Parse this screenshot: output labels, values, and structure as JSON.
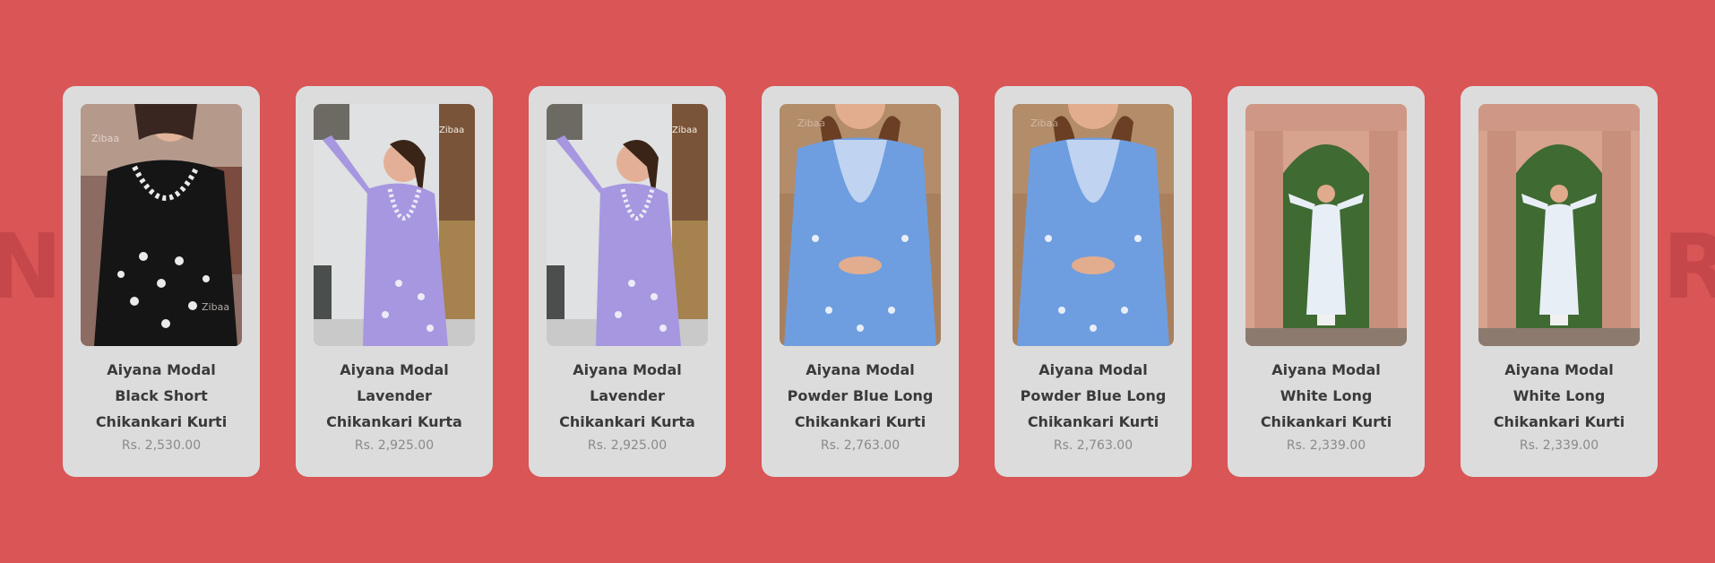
{
  "background": {
    "left_text": "N",
    "right_text": "R",
    "color": "#d95556"
  },
  "products": [
    {
      "title": "Aiyana Modal Black Short Chikankari Kurti",
      "price": "Rs. 2,530.00",
      "image": "woman-black-kurti-photo",
      "watermark": "Zibaa"
    },
    {
      "title": "Aiyana Modal Lavender Chikankari Kurta",
      "price": "Rs. 2,925.00",
      "image": "woman-lavender-kurta-photo",
      "watermark": "Zibaa"
    },
    {
      "title": "Aiyana Modal Lavender Chikankari Kurta",
      "price": "Rs. 2,925.00",
      "image": "woman-lavender-kurta-photo",
      "watermark": "Zibaa"
    },
    {
      "title": "Aiyana Modal Powder Blue Long Chikankari Kurti",
      "price": "Rs. 2,763.00",
      "image": "woman-powder-blue-kurti-photo",
      "watermark": "Zibaa"
    },
    {
      "title": "Aiyana Modal Powder Blue Long Chikankari Kurti",
      "price": "Rs. 2,763.00",
      "image": "woman-powder-blue-kurti-photo",
      "watermark": "Zibaa"
    },
    {
      "title": "Aiyana Modal White Long Chikankari Kurti",
      "price": "Rs. 2,339.00",
      "image": "woman-white-kurti-photo",
      "watermark": ""
    },
    {
      "title": "Aiyana Modal White Long Chikankari Kurti",
      "price": "Rs. 2,339.00",
      "image": "woman-white-kurti-photo",
      "watermark": ""
    }
  ]
}
